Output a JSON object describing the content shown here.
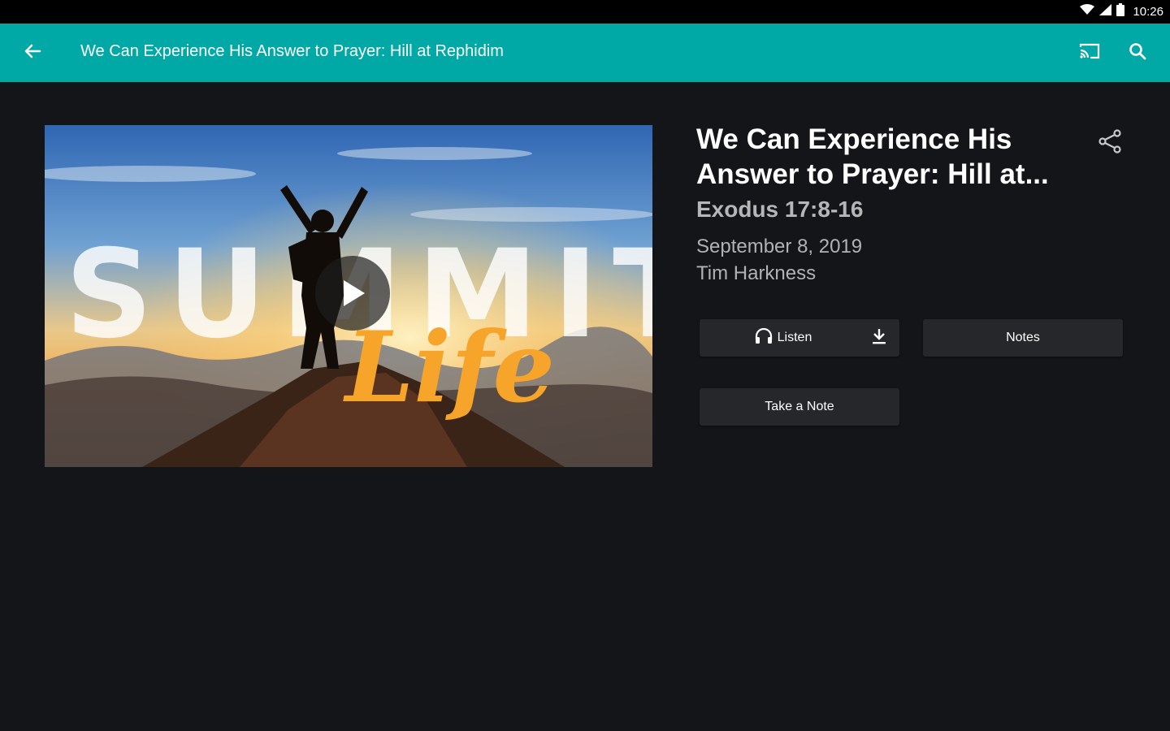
{
  "status_bar": {
    "time": "10:26",
    "icons": [
      "wifi-icon",
      "signal-icon",
      "battery-icon"
    ]
  },
  "app_bar": {
    "title": "We Can Experience His Answer to Prayer: Hill at Rephidim",
    "color": "#00a9a5",
    "icons": [
      "back-arrow-icon",
      "cast-icon",
      "search-icon"
    ]
  },
  "media": {
    "artwork_text_main": "SUMMIT",
    "artwork_text_script": "Life",
    "play_icon": "play-icon"
  },
  "sermon": {
    "title": "We Can Experience His Answer to Prayer: Hill at...",
    "scripture": "Exodus 17:8-16",
    "date": "September 8, 2019",
    "speaker": "Tim Harkness",
    "share_icon": "share-icon"
  },
  "actions": {
    "listen_label": "Listen",
    "notes_label": "Notes",
    "take_note_label": "Take a Note"
  },
  "colors": {
    "background": "#131518",
    "button": "#25272a",
    "accent": "#00a9a5",
    "muted_text": "#b0b2b4"
  }
}
